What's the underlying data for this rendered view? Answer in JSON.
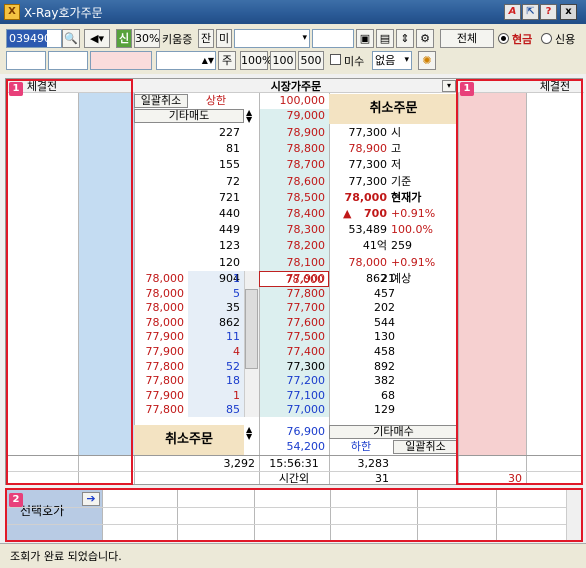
{
  "window": {
    "title": "X-Ray호가주문",
    "app_icon": "X",
    "buttons": [
      "A",
      "?",
      "x"
    ]
  },
  "toolbar": {
    "code": "039490",
    "credit_label": "신",
    "percent": "30%",
    "broker": "키움증",
    "jan": "잔",
    "mi": "미",
    "cash": "현금",
    "credit": "신용",
    "order_label": "전체",
    "ju": "주",
    "qty_btns": [
      "100%",
      "100",
      "500"
    ],
    "misu": "미수",
    "misu_sel": "없음"
  },
  "left_header": "체결전",
  "right_header": "체결전",
  "center_header": "시장가주문",
  "buttons": {
    "cancel_all_top": "일괄취소",
    "upper": "상한",
    "upper_price": "100,000",
    "other_sell": "기타매도",
    "top_price": "79,000",
    "cancel_top": "취소주문",
    "cancel_bottom": "취소주문",
    "other_buy": "기타매수",
    "lower_price_left": "76,900",
    "lower_price": "54,200",
    "lower": "하한",
    "cancel_all_bottom": "일괄취소"
  },
  "asks": [
    {
      "qty": "227",
      "price": "78,900"
    },
    {
      "qty": "81",
      "price": "78,800"
    },
    {
      "qty": "155",
      "price": "78,700"
    },
    {
      "qty": "72",
      "price": "78,600"
    },
    {
      "qty": "721",
      "price": "78,500"
    },
    {
      "qty": "440",
      "price": "78,400"
    },
    {
      "qty": "449",
      "price": "78,300"
    },
    {
      "qty": "123",
      "price": "78,200"
    },
    {
      "qty": "120",
      "price": "78,100"
    },
    {
      "qty": "904",
      "price": "78,000"
    }
  ],
  "info": [
    {
      "a": "77,300",
      "b": "시"
    },
    {
      "a": "78,900",
      "b": "고"
    },
    {
      "a": "77,300",
      "b": "저"
    },
    {
      "a": "77,300",
      "b": "기준"
    },
    {
      "a": "78,000",
      "b": "현재가"
    },
    {
      "a": "700",
      "b": "+0.91%"
    },
    {
      "a": "53,489",
      "b": "100.0%"
    },
    {
      "a": "41억",
      "b": "259"
    },
    {
      "a": "78,000",
      "b": "+0.91%"
    },
    {
      "a": "862",
      "b": "예상"
    }
  ],
  "bids": [
    {
      "price": "77,900",
      "qty": "21"
    },
    {
      "price": "77,800",
      "qty": "457"
    },
    {
      "price": "77,700",
      "qty": "202"
    },
    {
      "price": "77,600",
      "qty": "544"
    },
    {
      "price": "77,500",
      "qty": "130"
    },
    {
      "price": "77,400",
      "qty": "458"
    },
    {
      "price": "77,300",
      "qty": "892"
    },
    {
      "price": "77,200",
      "qty": "382"
    },
    {
      "price": "77,100",
      "qty": "68"
    },
    {
      "price": "77,000",
      "qty": "129"
    }
  ],
  "ticks": [
    {
      "p": "78,000",
      "q": "1"
    },
    {
      "p": "78,000",
      "q": "5"
    },
    {
      "p": "78,000",
      "q": "35"
    },
    {
      "p": "78,000",
      "q": "862"
    },
    {
      "p": "77,900",
      "q": "11"
    },
    {
      "p": "77,900",
      "q": "4"
    },
    {
      "p": "77,800",
      "q": "52"
    },
    {
      "p": "77,800",
      "q": "18"
    },
    {
      "p": "77,900",
      "q": "1"
    },
    {
      "p": "77,800",
      "q": "85"
    }
  ],
  "totals": {
    "ask_total": "3,292",
    "time": "15:56:31",
    "bid_total": "3,283",
    "after": "시간외",
    "after_a": "31",
    "after_b": "30"
  },
  "bottom": {
    "label": "선택호가"
  },
  "status": "조회가 완료 되었습니다."
}
